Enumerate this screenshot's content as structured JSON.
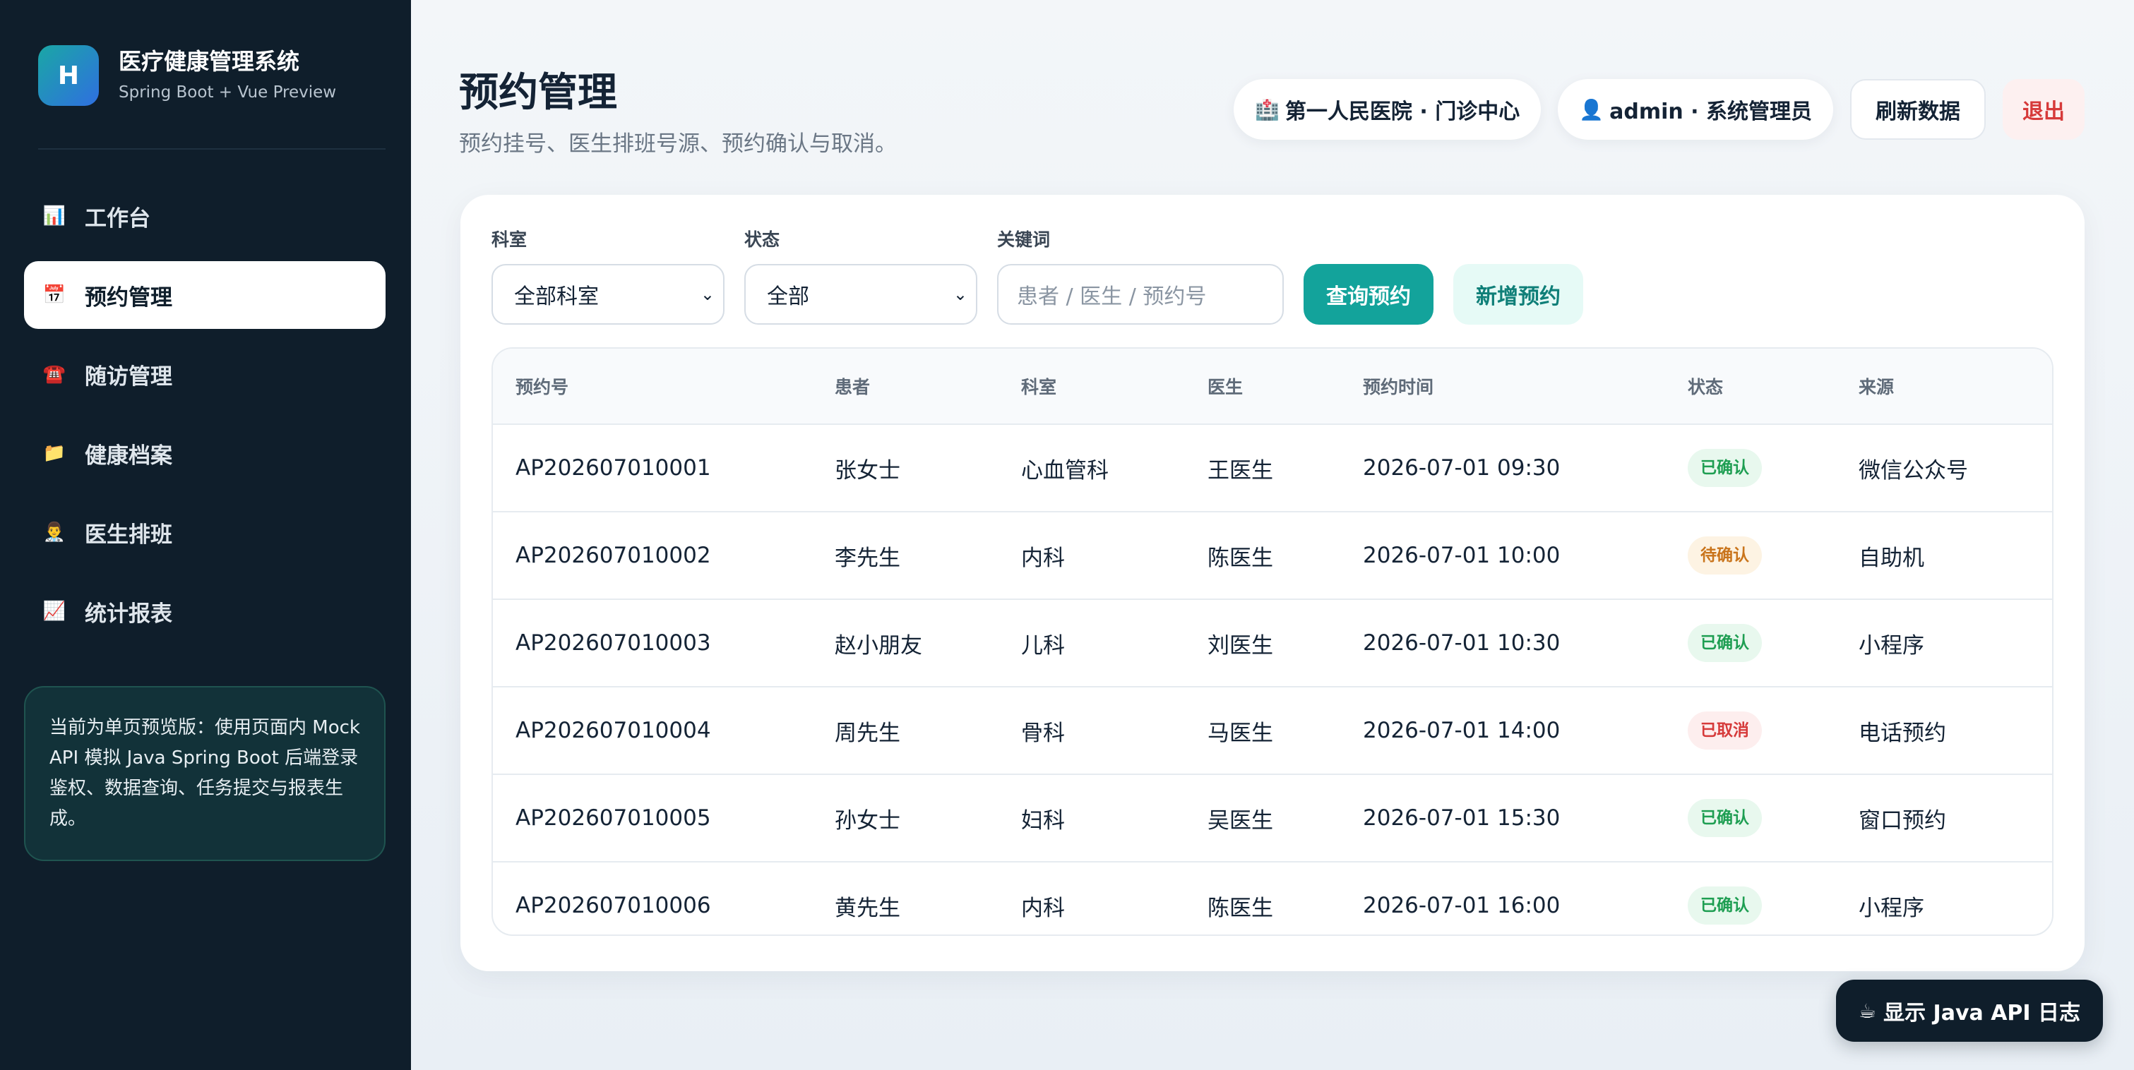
{
  "brand": {
    "logo_letter": "H",
    "title": "医疗健康管理系统",
    "subtitle": "Spring Boot + Vue Preview"
  },
  "sidebar": {
    "items": [
      {
        "icon": "📊",
        "icon_name": "bar-chart-icon",
        "label": "工作台",
        "active": false
      },
      {
        "icon": "📅",
        "icon_name": "calendar-icon",
        "label": "预约管理",
        "active": true
      },
      {
        "icon": "☎️",
        "icon_name": "telephone-icon",
        "label": "随访管理",
        "active": false
      },
      {
        "icon": "📁",
        "icon_name": "folder-icon",
        "label": "健康档案",
        "active": false
      },
      {
        "icon": "👨‍⚕️",
        "icon_name": "doctor-icon",
        "label": "医生排班",
        "active": false
      },
      {
        "icon": "📈",
        "icon_name": "line-chart-icon",
        "label": "统计报表",
        "active": false
      }
    ],
    "notice": "当前为单页预览版：使用页面内 Mock API 模拟 Java Spring Boot 后端登录鉴权、数据查询、任务提交与报表生成。"
  },
  "header": {
    "title": "预约管理",
    "subtitle": "预约挂号、医生排班号源、预约确认与取消。",
    "hospital": {
      "icon": "🏥",
      "label": "第一人民医院 · 门诊中心"
    },
    "user": {
      "icon": "👤",
      "label": "admin · 系统管理员"
    },
    "refresh_label": "刷新数据",
    "logout_label": "退出"
  },
  "filters": {
    "department": {
      "label": "科室",
      "value": "全部科室"
    },
    "status": {
      "label": "状态",
      "value": "全部"
    },
    "keyword": {
      "label": "关键词",
      "placeholder": "患者 / 医生 / 预约号"
    },
    "query_label": "查询预约",
    "new_label": "新增预约"
  },
  "table": {
    "columns": [
      "预约号",
      "患者",
      "科室",
      "医生",
      "预约时间",
      "状态",
      "来源"
    ],
    "rows": [
      {
        "id": "AP202607010001",
        "patient": "张女士",
        "dept": "心血管科",
        "doctor": "王医生",
        "time": "2026-07-01 09:30",
        "status": "已确认",
        "status_type": "ok",
        "source": "微信公众号"
      },
      {
        "id": "AP202607010002",
        "patient": "李先生",
        "dept": "内科",
        "doctor": "陈医生",
        "time": "2026-07-01 10:00",
        "status": "待确认",
        "status_type": "wait",
        "source": "自助机"
      },
      {
        "id": "AP202607010003",
        "patient": "赵小朋友",
        "dept": "儿科",
        "doctor": "刘医生",
        "time": "2026-07-01 10:30",
        "status": "已确认",
        "status_type": "ok",
        "source": "小程序"
      },
      {
        "id": "AP202607010004",
        "patient": "周先生",
        "dept": "骨科",
        "doctor": "马医生",
        "time": "2026-07-01 14:00",
        "status": "已取消",
        "status_type": "cancel",
        "source": "电话预约"
      },
      {
        "id": "AP202607010005",
        "patient": "孙女士",
        "dept": "妇科",
        "doctor": "吴医生",
        "time": "2026-07-01 15:30",
        "status": "已确认",
        "status_type": "ok",
        "source": "窗口预约"
      },
      {
        "id": "AP202607010006",
        "patient": "黄先生",
        "dept": "内科",
        "doctor": "陈医生",
        "time": "2026-07-01 16:00",
        "status": "已确认",
        "status_type": "ok",
        "source": "小程序"
      }
    ]
  },
  "api_log": {
    "icon": "☕",
    "label": "显示 Java API 日志"
  },
  "colors": {
    "sidebar_bg": "#0f1e2b",
    "accent": "#13a39b",
    "danger": "#d63a3a",
    "warning": "#c9741b",
    "success": "#1e9e52"
  }
}
